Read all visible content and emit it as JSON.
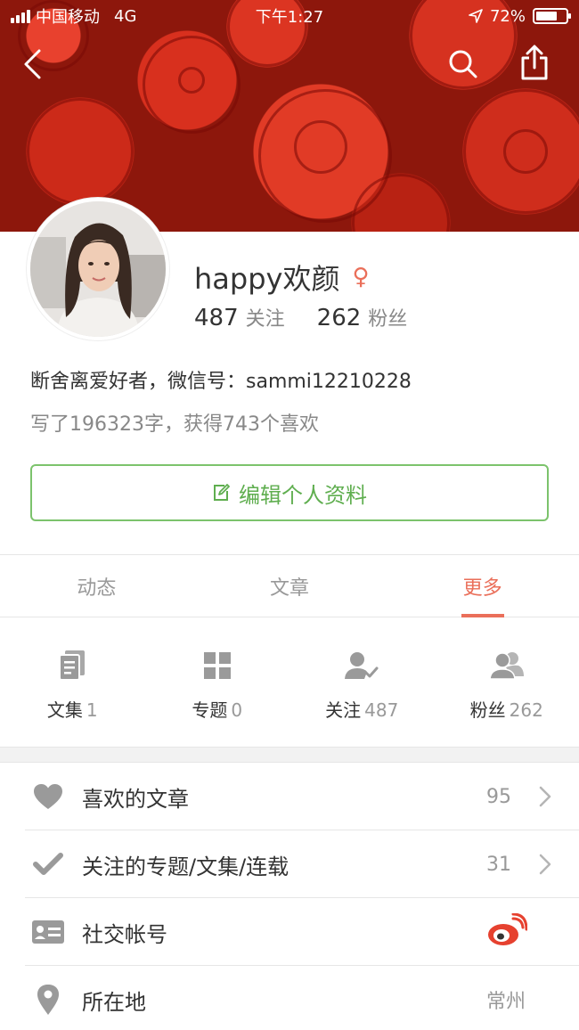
{
  "statusbar": {
    "carrier": "中国移动",
    "network": "4G",
    "time": "下午1:27",
    "battery": "72%",
    "battery_level": 0.72
  },
  "profile": {
    "username": "happy欢颜",
    "gender_symbol": "♀",
    "following_count": "487",
    "following_label": "关注",
    "followers_count": "262",
    "followers_label": "粉丝",
    "bio": "断舍离爱好者，微信号：sammi12210228",
    "stats_line": "写了196323字，获得743个喜欢",
    "edit_button": "编辑个人资料"
  },
  "tabs": [
    {
      "label": "动态",
      "active": false
    },
    {
      "label": "文章",
      "active": false
    },
    {
      "label": "更多",
      "active": true
    }
  ],
  "grid": [
    {
      "label": "文集",
      "count": "1",
      "icon": "notebook-icon"
    },
    {
      "label": "专题",
      "count": "0",
      "icon": "grid-squares-icon"
    },
    {
      "label": "关注",
      "count": "487",
      "icon": "user-check-icon"
    },
    {
      "label": "粉丝",
      "count": "262",
      "icon": "users-icon"
    }
  ],
  "list": [
    {
      "label": "喜欢的文章",
      "value": "95",
      "icon": "heart-icon",
      "arrow": true
    },
    {
      "label": "关注的专题/文集/连载",
      "value": "31",
      "icon": "checkmark-icon",
      "arrow": true
    },
    {
      "label": "社交帐号",
      "value": "",
      "icon": "id-card-icon",
      "arrow": false,
      "trailing_icon": "weibo-icon"
    },
    {
      "label": "所在地",
      "value": "常州",
      "icon": "location-pin-icon",
      "arrow": false
    }
  ],
  "colors": {
    "accent": "#ea6f5a",
    "green": "#5fae4f",
    "icon_gray": "#9a9a9a"
  }
}
